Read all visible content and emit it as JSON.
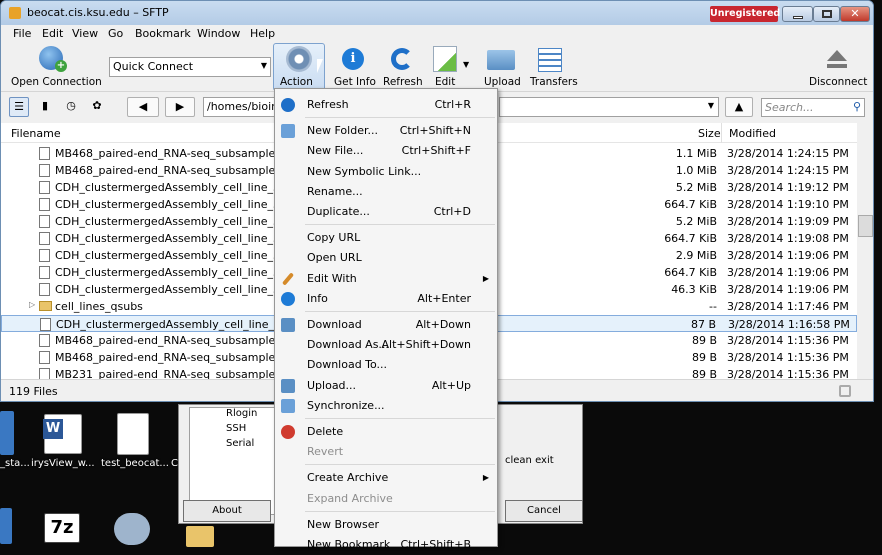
{
  "window": {
    "title": "beocat.cis.ksu.edu – SFTP",
    "unregistered": "Unregistered"
  },
  "menu": [
    "File",
    "Edit",
    "View",
    "Go",
    "Bookmark",
    "Window",
    "Help"
  ],
  "toolbar": {
    "open_connection": "Open Connection",
    "quick_connect": "Quick Connect",
    "action": "Action",
    "get_info": "Get Info",
    "refresh": "Refresh",
    "edit": "Edit",
    "upload": "Upload",
    "transfers": "Transfers",
    "disconnect": "Disconnect"
  },
  "nav": {
    "path": "/homes/bioin",
    "search_placeholder": "Search..."
  },
  "columns": {
    "filename": "Filename",
    "size": "Size",
    "modified": "Modified"
  },
  "files": [
    {
      "name": "MB468_paired-end_RNA-seq_subsampled_1_b",
      "size": "1.1 MiB",
      "modified": "3/28/2014 1:24:15 PM",
      "type": "file"
    },
    {
      "name": "MB468_paired-end_RNA-seq_subsampled_1_b",
      "size": "1.0 MiB",
      "modified": "3/28/2014 1:24:15 PM",
      "type": "file"
    },
    {
      "name": "CDH_clustermergedAssembly_cell_line_33_gt",
      "size": "5.2 MiB",
      "modified": "3/28/2014 1:19:12 PM",
      "type": "file"
    },
    {
      "name": "CDH_clustermergedAssembly_cell_line_33_gt",
      "size": "664.7 KiB",
      "modified": "3/28/2014 1:19:10 PM",
      "type": "file"
    },
    {
      "name": "CDH_clustermergedAssembly_cell_line_33_gt",
      "size": "5.2 MiB",
      "modified": "3/28/2014 1:19:09 PM",
      "type": "file"
    },
    {
      "name": "CDH_clustermergedAssembly_cell_line_33_gt",
      "size": "664.7 KiB",
      "modified": "3/28/2014 1:19:08 PM",
      "type": "file"
    },
    {
      "name": "CDH_clustermergedAssembly_cell_line_33_gt",
      "size": "2.9 MiB",
      "modified": "3/28/2014 1:19:06 PM",
      "type": "doc"
    },
    {
      "name": "CDH_clustermergedAssembly_cell_line_33_gt",
      "size": "664.7 KiB",
      "modified": "3/28/2014 1:19:06 PM",
      "type": "file"
    },
    {
      "name": "CDH_clustermergedAssembly_cell_line_33_gt",
      "size": "46.3 KiB",
      "modified": "3/28/2014 1:19:06 PM",
      "type": "file"
    },
    {
      "name": "cell_lines_qsubs",
      "size": "--",
      "modified": "3/28/2014 1:17:46 PM",
      "type": "folder"
    },
    {
      "name": "CDH_clustermergedAssembly_cell_line_33.fa",
      "size": "87 B",
      "modified": "3/28/2014 1:16:58 PM",
      "type": "file",
      "selected": true
    },
    {
      "name": "MB468_paired-end_RNA-seq_subsampled_2.fa",
      "size": "89 B",
      "modified": "3/28/2014 1:15:36 PM",
      "type": "file"
    },
    {
      "name": "MB468_paired-end_RNA-seq_subsampled_1.fa",
      "size": "89 B",
      "modified": "3/28/2014 1:15:36 PM",
      "type": "file"
    },
    {
      "name": "MB231_paired-end_RNA-seq_subsampled_2.fa",
      "size": "89 B",
      "modified": "3/28/2014 1:15:36 PM",
      "type": "file"
    }
  ],
  "status": {
    "count": "119 Files"
  },
  "context_menu": [
    {
      "label": "Refresh",
      "shortcut": "Ctrl+R",
      "icon": "refresh-icon"
    },
    {
      "sep": true
    },
    {
      "label": "New Folder...",
      "shortcut": "Ctrl+Shift+N",
      "icon": "new-folder-icon"
    },
    {
      "label": "New File...",
      "shortcut": "Ctrl+Shift+F"
    },
    {
      "label": "New Symbolic Link..."
    },
    {
      "label": "Rename..."
    },
    {
      "label": "Duplicate...",
      "shortcut": "Ctrl+D"
    },
    {
      "sep": true
    },
    {
      "label": "Copy URL"
    },
    {
      "label": "Open URL"
    },
    {
      "label": "Edit With",
      "submenu": true,
      "icon": "pencil-icon"
    },
    {
      "label": "Info",
      "shortcut": "Alt+Enter",
      "icon": "info-icon"
    },
    {
      "sep": true
    },
    {
      "label": "Download",
      "shortcut": "Alt+Down",
      "icon": "download-icon"
    },
    {
      "label": "Download As...",
      "shortcut": "Alt+Shift+Down"
    },
    {
      "label": "Download To..."
    },
    {
      "label": "Upload...",
      "shortcut": "Alt+Up",
      "icon": "upload-icon"
    },
    {
      "label": "Synchronize...",
      "icon": "sync-icon"
    },
    {
      "sep": true
    },
    {
      "label": "Delete",
      "icon": "delete-icon"
    },
    {
      "label": "Revert",
      "disabled": true
    },
    {
      "sep": true
    },
    {
      "label": "Create Archive",
      "submenu": true
    },
    {
      "label": "Expand Archive",
      "disabled": true
    },
    {
      "sep": true
    },
    {
      "label": "New Browser"
    },
    {
      "label": "New Bookmark",
      "shortcut": "Ctrl+Shift+B"
    }
  ],
  "background_dialog": {
    "tree": [
      "Rlogin",
      "SSH",
      "Serial"
    ],
    "about": "About",
    "cancel": "Cancel",
    "clean_exit": "clean exit"
  },
  "desktop": {
    "labels": [
      "_sta...",
      "irysView_w...",
      "test_beocat...",
      "C"
    ]
  },
  "colors": {
    "unregistered": "#c8262f",
    "selection": "#e5f1fb",
    "titlebar": "#b3cbe6"
  }
}
